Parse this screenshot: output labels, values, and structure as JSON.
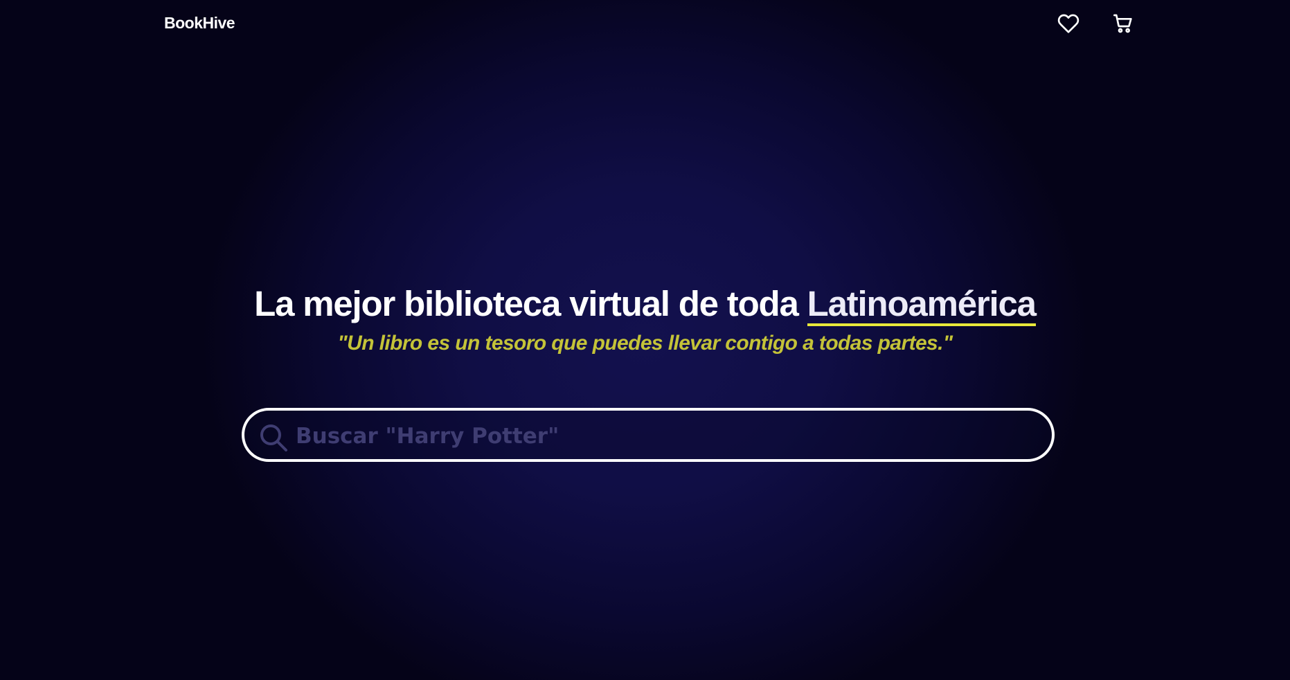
{
  "nav": {
    "brand": "BookHive",
    "icons": [
      "heart-icon",
      "cart-icon"
    ]
  },
  "hero": {
    "title_prefix": "La mejor biblioteca virtual de toda ",
    "title_highlight": "Latinoamérica",
    "quote": "\"Un libro es un tesoro que puedes llevar contigo a todas partes.\""
  },
  "search": {
    "placeholder": "Buscar \"Harry Potter\"",
    "value": "",
    "icon": "search-icon"
  },
  "colors": {
    "background": "#100e45",
    "accent_underline": "#e8e83a",
    "quote_text": "#c4c338",
    "placeholder_text": "#3f3d72"
  }
}
